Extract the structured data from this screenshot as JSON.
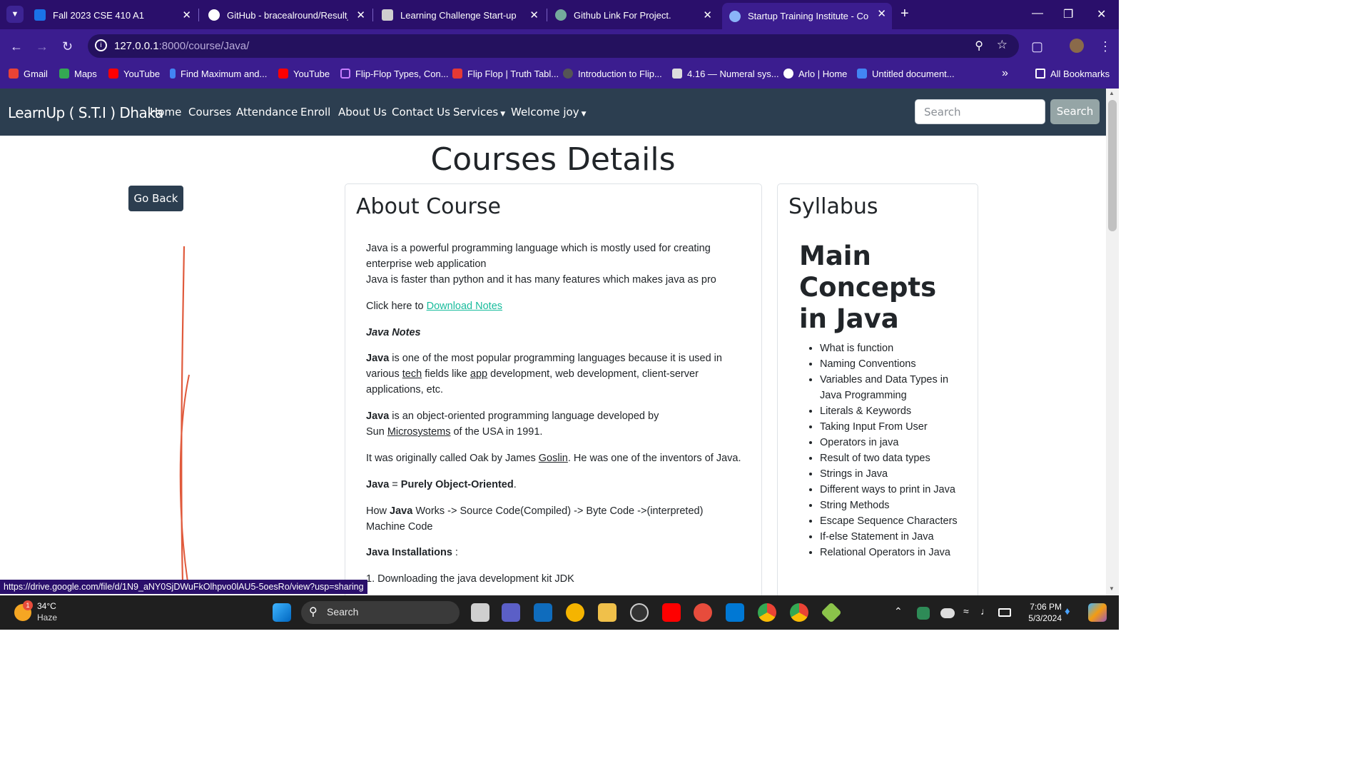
{
  "tabs": [
    {
      "title": "Fall 2023 CSE 410 A1",
      "color": "#1a73e8"
    },
    {
      "title": "GitHub - bracealround/Result_F",
      "color": "#ffffff"
    },
    {
      "title": "Learning Challenge Start-up",
      "color": "#444444"
    },
    {
      "title": "Github Link For Project.",
      "color": "#74aa9c"
    },
    {
      "title": "Startup Training Institute - Cour",
      "color": "#8ab4f8"
    }
  ],
  "address": {
    "host": "127.0.0.1",
    "path": ":8000/course/Java/"
  },
  "bookmarks": [
    "Gmail",
    "Maps",
    "YouTube",
    "Find Maximum and...",
    "YouTube",
    "Flip-Flop Types, Con...",
    "Flip Flop | Truth Tabl...",
    "Introduction to Flip...",
    "4.16 — Numeral sys...",
    "Arlo | Home",
    "Untitled document...",
    "All Bookmarks"
  ],
  "site": {
    "brand": "LearnUp ( S.T.I ) Dhaka",
    "nav": [
      "Home",
      "Courses",
      "Attendance",
      "Enroll",
      "About Us",
      "Contact Us",
      "Services",
      "Welcome joy"
    ],
    "search_placeholder": "Search",
    "search_button": "Search"
  },
  "page": {
    "title": "Courses Details",
    "go_back": "Go Back",
    "about_heading": "About Course",
    "about": {
      "p1": "Java is a powerful programming language which is mostly used for creating enterprise web application",
      "p1b": "Java is faster than python and it has many features which makes java as pro",
      "click_prefix": "Click here to ",
      "download_link": "Download Notes",
      "notes_title": "Java Notes",
      "p2_bold": "Java",
      "p2": " is one of the most popular programming languages because it is used in various ",
      "p2_tech": "tech",
      "p2_mid": " fields like ",
      "p2_app": "app",
      "p2_end": " development, web development, client-server applications, etc.",
      "p3_bold": "Java",
      "p3": " is an object-oriented programming language developed by Sun ",
      "p3_ms": "Microsystems",
      "p3_end": " of the USA in 1991.",
      "p4": "It was originally called Oak by James ",
      "p4_goslin": "Goslin",
      "p4_end": ". He was one of the inventors of Java.",
      "p5_a": "Java",
      "p5_b": " = ",
      "p5_c": "Purely Object-Oriented",
      "p5_d": ".",
      "p6_a": "How ",
      "p6_bold": "Java",
      "p6_b": " Works -> Source Code(Compiled) -> Byte Code ->(interpreted) Machine Code",
      "install_title": "Java Installations",
      "install_colon": " :",
      "step1": "1. Downloading the java development kit JDK"
    },
    "syllabus_heading": "Syllabus",
    "syllabus_title": "Main Concepts in Java",
    "syllabus_items": [
      "What is function",
      "Naming Conventions",
      "Variables and Data Types in Java Programming",
      "Literals & Keywords",
      "Taking Input From User",
      "Operators in java",
      "Result of two data types",
      "Strings in Java",
      "Different ways to print in Java",
      "String Methods",
      "Escape Sequence Characters",
      "If-else Statement in Java",
      "Relational Operators in Java"
    ]
  },
  "status_url": "https://drive.google.com/file/d/1N9_aNY0SjDWuFkOlhpvo0lAU5-5oesRo/view?usp=sharing",
  "taskbar": {
    "weather_temp": "34°C",
    "weather_desc": "Haze",
    "weather_badge": "1",
    "search": "Search",
    "time": "7:06 PM",
    "date": "5/3/2024"
  },
  "colors": {
    "nav_bg": "#2c3e50",
    "link": "#18bc9c",
    "browser": "#3b1d8f"
  }
}
